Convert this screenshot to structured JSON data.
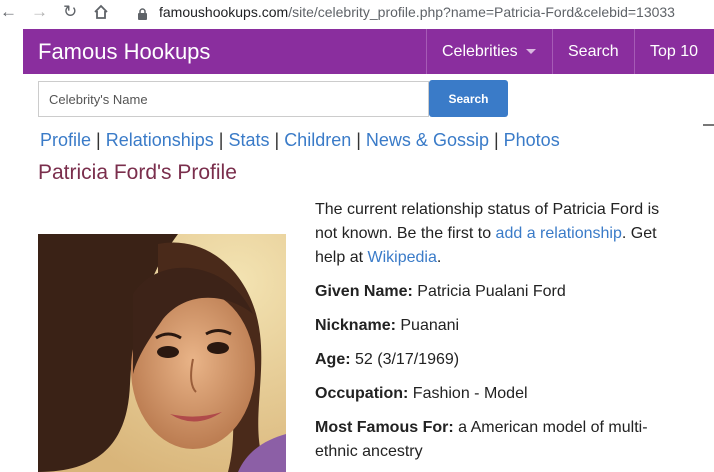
{
  "browser": {
    "url_host": "famoushookups.com",
    "url_path": "/site/celebrity_profile.php?name=Patricia-Ford&celebid=13033"
  },
  "navbar": {
    "brand": "Famous Hookups",
    "items": [
      {
        "label": "Celebrities"
      },
      {
        "label": "Search"
      },
      {
        "label": "Top 10"
      }
    ],
    "color": "#8a2e9e"
  },
  "search": {
    "placeholder": "Celebrity's Name",
    "button_label": "Search"
  },
  "tabs": {
    "items": [
      {
        "label": "Profile"
      },
      {
        "label": "Relationships"
      },
      {
        "label": "Stats"
      },
      {
        "label": "Children"
      },
      {
        "label": "News & Gossip"
      },
      {
        "label": "Photos"
      }
    ],
    "separator": "|"
  },
  "profile": {
    "title": "Patricia Ford's Profile",
    "status_pre": "The current relationship status of Patricia Ford is not known. Be the first to ",
    "status_link": "add a relationship",
    "status_mid": ". Get help at ",
    "status_link2": "Wikipedia",
    "status_post": ".",
    "fields": [
      {
        "label": "Given Name:",
        "value": "Patricia Pualani Ford"
      },
      {
        "label": "Nickname:",
        "value": "Puanani"
      },
      {
        "label": "Age:",
        "value": "52 (3/17/1969)"
      },
      {
        "label": "Occupation:",
        "value": "Fashion - Model"
      },
      {
        "label": "Most Famous For:",
        "value": "a American model of multi-ethnic ancestry"
      }
    ]
  }
}
